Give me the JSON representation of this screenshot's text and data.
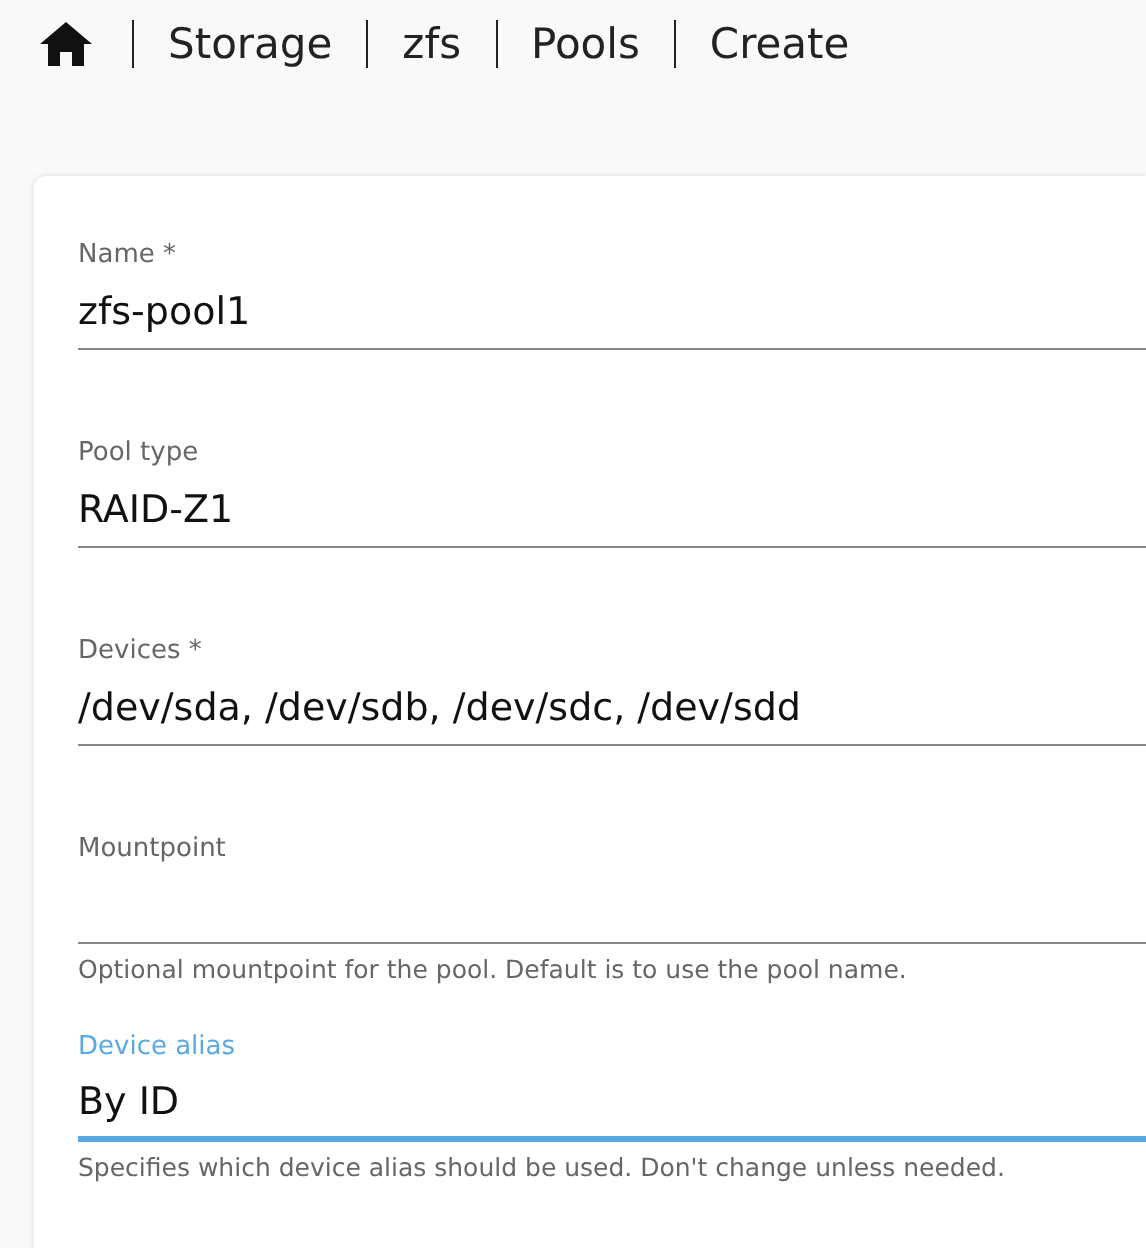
{
  "breadcrumb": [
    {
      "label": "Storage"
    },
    {
      "label": "zfs"
    },
    {
      "label": "Pools"
    },
    {
      "label": "Create"
    }
  ],
  "fields": [
    {
      "label": "Name *",
      "value": "zfs-pool1",
      "focused": false
    },
    {
      "label": "Pool type",
      "value": "RAID-Z1",
      "focused": false
    },
    {
      "label": "Devices *",
      "value": "/dev/sda, /dev/sdb, /dev/sdc, /dev/sdd",
      "focused": false
    },
    {
      "label": "Mountpoint",
      "helper": "Optional mountpoint for the pool. Default is to use the pool name.",
      "focused": false
    },
    {
      "label": "Device alias",
      "value": "By ID",
      "helper": "Specifies which device alias should be used. Don't change unless needed.",
      "focused": true
    }
  ]
}
